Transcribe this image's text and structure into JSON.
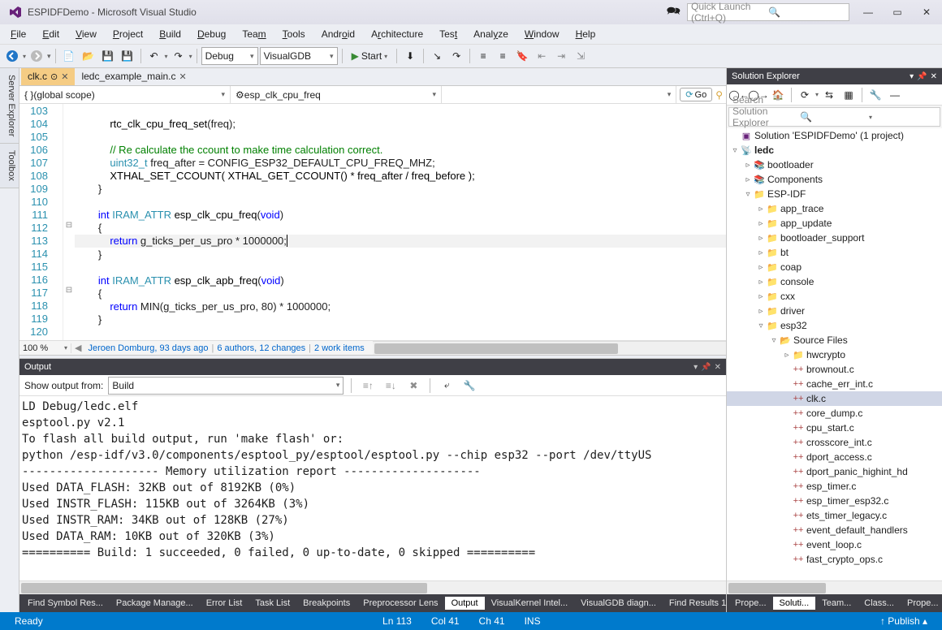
{
  "title": "ESPIDFDemo - Microsoft Visual Studio",
  "quick_launch_placeholder": "Quick Launch (Ctrl+Q)",
  "menu": [
    "File",
    "Edit",
    "View",
    "Project",
    "Build",
    "Debug",
    "Team",
    "Tools",
    "Android",
    "Architecture",
    "Test",
    "Analyze",
    "Window",
    "Help"
  ],
  "menu_underline_index": [
    0,
    0,
    0,
    0,
    0,
    0,
    3,
    0,
    4,
    1,
    3,
    4,
    0,
    0
  ],
  "config_combo": "Debug",
  "platform_combo": "VisualGDB",
  "start_label": "Start",
  "editor_tabs": [
    {
      "name": "clk.c",
      "active": true,
      "pinned": true
    },
    {
      "name": "ledc_example_main.c",
      "active": false,
      "pinned": false
    }
  ],
  "combo_bar": {
    "scope": "(global scope)",
    "member": "esp_clk_cpu_freq",
    "third": ""
  },
  "go_label": "Go",
  "code": {
    "first_line_no": 103,
    "lines": [
      {
        "indent": 2,
        "tokens": []
      },
      {
        "indent": 3,
        "tokens": [
          {
            "t": "rtc_clk_cpu_freq_set",
            "c": "fn"
          },
          {
            "t": "(freq);",
            "c": ""
          }
        ]
      },
      {
        "indent": 0,
        "tokens": []
      },
      {
        "indent": 3,
        "tokens": [
          {
            "t": "// Re calculate the ccount to make time calculation correct.",
            "c": "cm"
          }
        ]
      },
      {
        "indent": 3,
        "tokens": [
          {
            "t": "uint32_t",
            "c": "ty"
          },
          {
            "t": " freq_after = CONFIG_ESP32_DEFAULT_CPU_FREQ_MHZ;",
            "c": ""
          }
        ]
      },
      {
        "indent": 3,
        "tokens": [
          {
            "t": "XTHAL_SET_CCOUNT( XTHAL_GET_CCOUNT() * freq_after / freq_before );",
            "c": "fn"
          }
        ]
      },
      {
        "indent": 2,
        "tokens": [
          {
            "t": "}",
            "c": ""
          }
        ]
      },
      {
        "indent": 0,
        "tokens": []
      },
      {
        "indent": 2,
        "tokens": [
          {
            "t": "int",
            "c": "kw"
          },
          {
            "t": " IRAM_ATTR ",
            "c": "ty"
          },
          {
            "t": "esp_clk_cpu_freq",
            "c": "fn"
          },
          {
            "t": "(",
            "c": ""
          },
          {
            "t": "void",
            "c": "kw"
          },
          {
            "t": ")",
            "c": ""
          }
        ]
      },
      {
        "indent": 2,
        "tokens": [
          {
            "t": "{",
            "c": ""
          }
        ],
        "fold": "⊟"
      },
      {
        "indent": 3,
        "tokens": [
          {
            "t": "return",
            "c": "kw"
          },
          {
            "t": " g_ticks_per_us_pro * 1000000;",
            "c": ""
          }
        ],
        "highlight": true,
        "caret": true
      },
      {
        "indent": 2,
        "tokens": [
          {
            "t": "}",
            "c": ""
          }
        ]
      },
      {
        "indent": 0,
        "tokens": []
      },
      {
        "indent": 2,
        "tokens": [
          {
            "t": "int",
            "c": "kw"
          },
          {
            "t": " IRAM_ATTR ",
            "c": "ty"
          },
          {
            "t": "esp_clk_apb_freq",
            "c": "fn"
          },
          {
            "t": "(",
            "c": ""
          },
          {
            "t": "void",
            "c": "kw"
          },
          {
            "t": ")",
            "c": ""
          }
        ]
      },
      {
        "indent": 2,
        "tokens": [
          {
            "t": "{",
            "c": ""
          }
        ],
        "fold": "⊟"
      },
      {
        "indent": 3,
        "tokens": [
          {
            "t": "return",
            "c": "kw"
          },
          {
            "t": " MIN(g_ticks_per_us_pro, 80) * 1000000;",
            "c": ""
          }
        ]
      },
      {
        "indent": 2,
        "tokens": [
          {
            "t": "}",
            "c": ""
          }
        ]
      },
      {
        "indent": 0,
        "tokens": []
      }
    ]
  },
  "zoom": "100 %",
  "codelens": {
    "nav": "◀",
    "author": "Jeroen Domburg, 93 days ago",
    "changes": "6 authors, 12 changes",
    "workitems": "2 work items"
  },
  "output": {
    "title": "Output",
    "show_from_label": "Show output from:",
    "source": "Build",
    "lines": [
      "LD Debug/ledc.elf",
      "esptool.py v2.1",
      "To flash all build output, run 'make flash' or:",
      "python /esp-idf/v3.0/components/esptool_py/esptool/esptool.py --chip esp32 --port /dev/ttyUS",
      "-------------------- Memory utilization report --------------------",
      "Used DATA_FLASH: 32KB out of 8192KB (0%)",
      "Used INSTR_FLASH: 115KB out of 3264KB (3%)",
      "Used INSTR_RAM: 34KB out of 128KB (27%)",
      "Used DATA_RAM: 10KB out of 320KB (3%)",
      "========== Build: 1 succeeded, 0 failed, 0 up-to-date, 0 skipped =========="
    ]
  },
  "bottom_tabs_center": [
    "Find Symbol Res...",
    "Package Manage...",
    "Error List",
    "Task List",
    "Breakpoints",
    "Preprocessor Lens",
    "Output",
    "VisualKernel Intel...",
    "VisualGDB diagn...",
    "Find Results 1"
  ],
  "bottom_tabs_center_active": "Output",
  "solution_explorer": {
    "title": "Solution Explorer",
    "search_placeholder": "Search Solution Explorer (Ctrl+;)",
    "tree": [
      {
        "depth": 0,
        "icon": "sln",
        "label": "Solution 'ESPIDFDemo' (1 project)",
        "exp": ""
      },
      {
        "depth": 0,
        "icon": "proj",
        "label": "ledc",
        "exp": "▿",
        "bold": true
      },
      {
        "depth": 1,
        "icon": "ref",
        "label": "bootloader",
        "exp": "▹"
      },
      {
        "depth": 1,
        "icon": "ref",
        "label": "Components",
        "exp": "▹"
      },
      {
        "depth": 1,
        "icon": "folder",
        "label": "ESP-IDF",
        "exp": "▿"
      },
      {
        "depth": 2,
        "icon": "folder",
        "label": "app_trace",
        "exp": "▹"
      },
      {
        "depth": 2,
        "icon": "folder",
        "label": "app_update",
        "exp": "▹"
      },
      {
        "depth": 2,
        "icon": "folder",
        "label": "bootloader_support",
        "exp": "▹"
      },
      {
        "depth": 2,
        "icon": "folder",
        "label": "bt",
        "exp": "▹"
      },
      {
        "depth": 2,
        "icon": "folder",
        "label": "coap",
        "exp": "▹"
      },
      {
        "depth": 2,
        "icon": "folder",
        "label": "console",
        "exp": "▹"
      },
      {
        "depth": 2,
        "icon": "folder",
        "label": "cxx",
        "exp": "▹"
      },
      {
        "depth": 2,
        "icon": "folder",
        "label": "driver",
        "exp": "▹"
      },
      {
        "depth": 2,
        "icon": "folder",
        "label": "esp32",
        "exp": "▿"
      },
      {
        "depth": 3,
        "icon": "filter",
        "label": "Source Files",
        "exp": "▿"
      },
      {
        "depth": 4,
        "icon": "folder",
        "label": "hwcrypto",
        "exp": "▹"
      },
      {
        "depth": 4,
        "icon": "cpp",
        "label": "brownout.c",
        "exp": ""
      },
      {
        "depth": 4,
        "icon": "cpp",
        "label": "cache_err_int.c",
        "exp": ""
      },
      {
        "depth": 4,
        "icon": "cpp",
        "label": "clk.c",
        "exp": "",
        "selected": true
      },
      {
        "depth": 4,
        "icon": "cpp",
        "label": "core_dump.c",
        "exp": ""
      },
      {
        "depth": 4,
        "icon": "cpp",
        "label": "cpu_start.c",
        "exp": ""
      },
      {
        "depth": 4,
        "icon": "cpp",
        "label": "crosscore_int.c",
        "exp": ""
      },
      {
        "depth": 4,
        "icon": "cpp",
        "label": "dport_access.c",
        "exp": ""
      },
      {
        "depth": 4,
        "icon": "cpp",
        "label": "dport_panic_highint_hd",
        "exp": ""
      },
      {
        "depth": 4,
        "icon": "cpp",
        "label": "esp_timer.c",
        "exp": ""
      },
      {
        "depth": 4,
        "icon": "cpp",
        "label": "esp_timer_esp32.c",
        "exp": ""
      },
      {
        "depth": 4,
        "icon": "cpp",
        "label": "ets_timer_legacy.c",
        "exp": ""
      },
      {
        "depth": 4,
        "icon": "cpp",
        "label": "event_default_handlers",
        "exp": ""
      },
      {
        "depth": 4,
        "icon": "cpp",
        "label": "event_loop.c",
        "exp": ""
      },
      {
        "depth": 4,
        "icon": "cpp",
        "label": "fast_crypto_ops.c",
        "exp": ""
      }
    ]
  },
  "bottom_tabs_right": [
    "Prope...",
    "Soluti...",
    "Team...",
    "Class...",
    "Prope..."
  ],
  "bottom_tabs_right_active": "Soluti...",
  "left_side_tabs": [
    "Server Explorer",
    "Toolbox"
  ],
  "status": {
    "ready": "Ready",
    "line": "Ln 113",
    "col": "Col 41",
    "ch": "Ch 41",
    "ins": "INS",
    "publish": "Publish"
  }
}
